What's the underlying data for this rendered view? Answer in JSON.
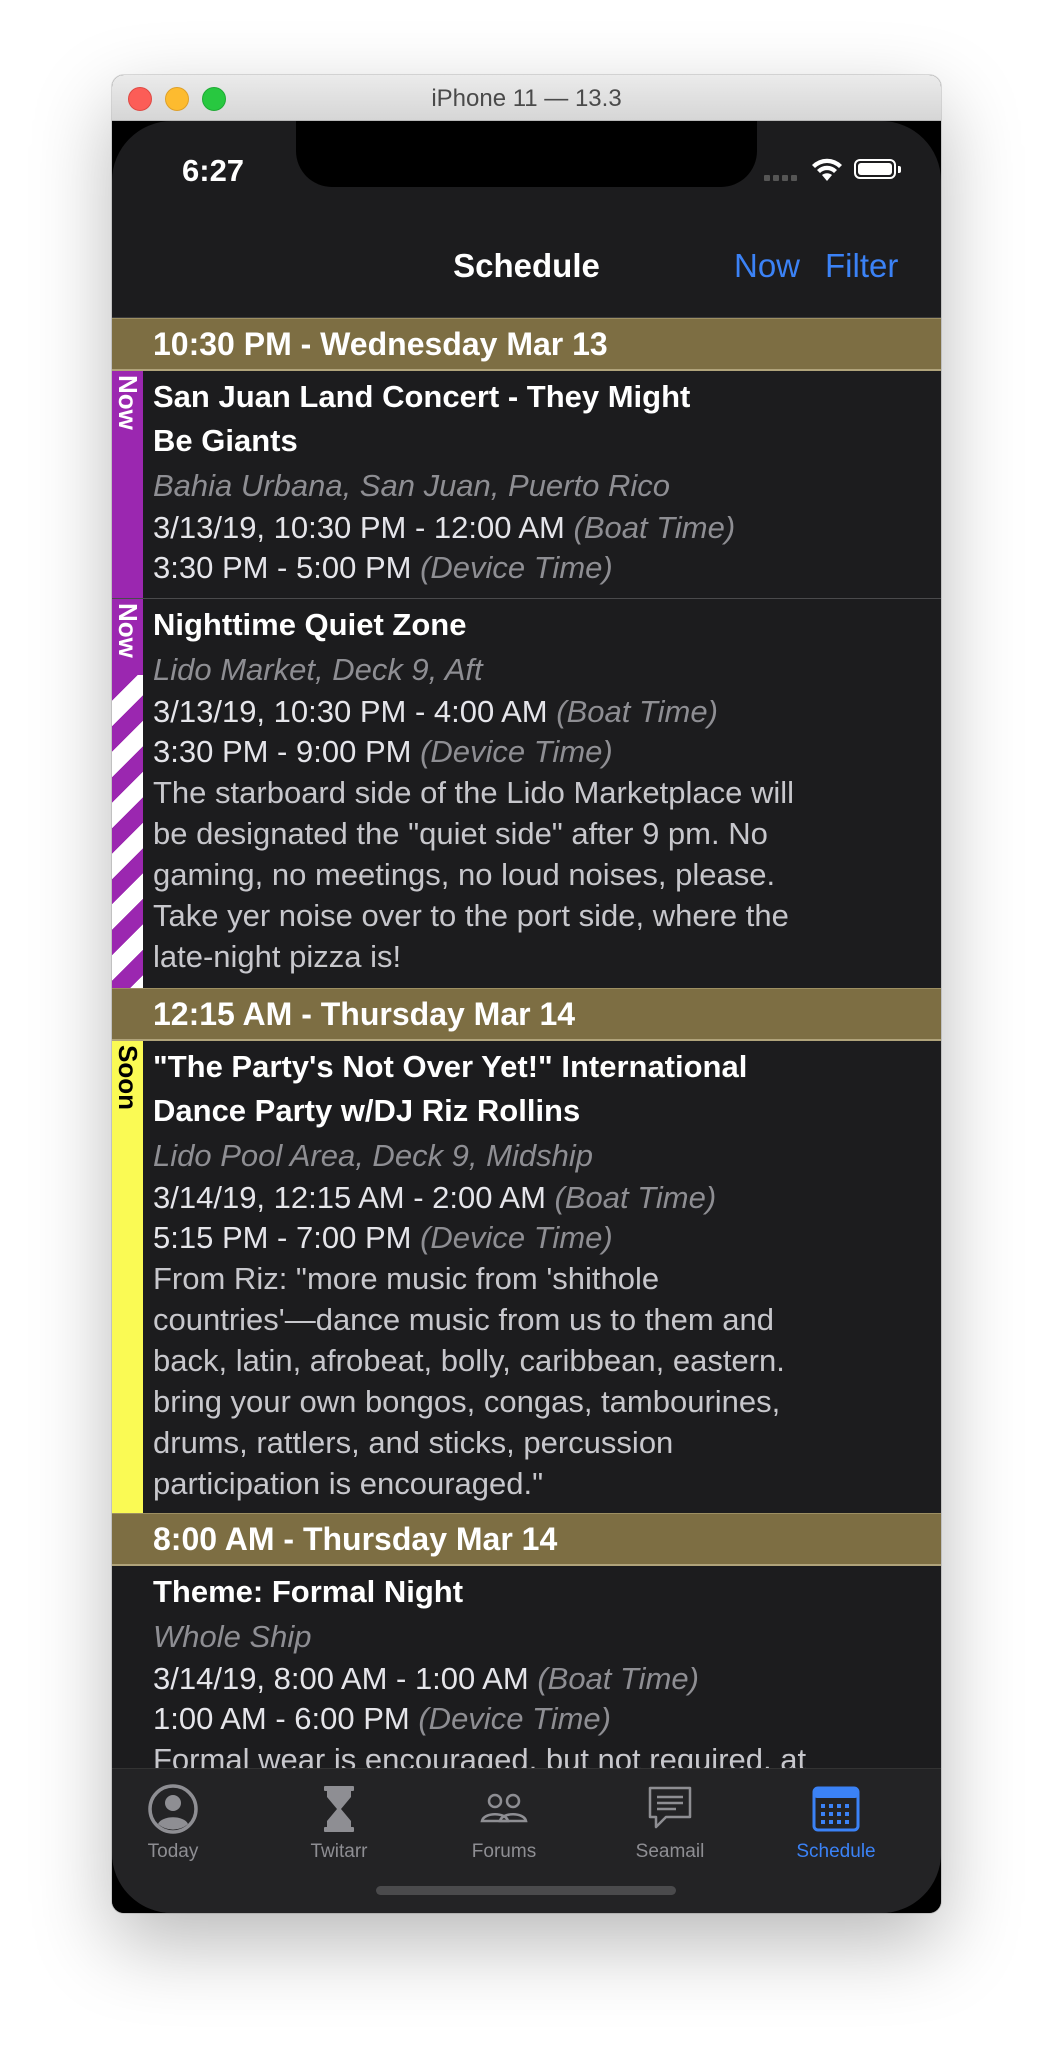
{
  "window": {
    "title": "iPhone 11 — 13.3"
  },
  "status_bar": {
    "time": "6:27"
  },
  "nav": {
    "title": "Schedule",
    "now_label": "Now",
    "filter_label": "Filter"
  },
  "sections": [
    {
      "header": "10:30 PM - Wednesday Mar 13",
      "events": [
        {
          "badge": "Now",
          "title_lines": [
            "San Juan Land Concert - They Might",
            "Be Giants"
          ],
          "location": "Bahia Urbana, San Juan, Puerto Rico",
          "boat_time": "3/13/19, 10:30 PM - 12:00 AM",
          "boat_label": "(Boat Time)",
          "device_time": "3:30 PM - 5:00 PM",
          "device_label": "(Device Time)"
        },
        {
          "badge": "Now",
          "title_lines": [
            "Nighttime Quiet Zone"
          ],
          "location": "Lido Market, Deck 9, Aft",
          "boat_time": "3/13/19, 10:30 PM - 4:00 AM",
          "boat_label": "(Boat Time)",
          "device_time": "3:30 PM - 9:00 PM",
          "device_label": "(Device Time)",
          "desc_lines": [
            "The starboard side of the Lido Marketplace will",
            "be designated the \"quiet side\" after 9 pm. No",
            "gaming, no meetings, no loud noises, please.",
            "Take yer noise over to the port side, where the",
            "late-night pizza is!"
          ]
        }
      ]
    },
    {
      "header": "12:15 AM - Thursday Mar 14",
      "events": [
        {
          "badge": "Soon",
          "title_lines": [
            "\"The Party's Not Over Yet!\" International",
            "Dance Party w/DJ Riz Rollins"
          ],
          "location": "Lido Pool Area, Deck 9, Midship",
          "boat_time": "3/14/19, 12:15 AM - 2:00 AM",
          "boat_label": "(Boat Time)",
          "device_time": "5:15 PM - 7:00 PM",
          "device_label": "(Device Time)",
          "desc_lines": [
            "From Riz: \"more music from 'shithole",
            "countries'—dance music from us to them and",
            "back, latin, afrobeat, bolly, caribbean, eastern.",
            "bring your own bongos, congas, tambourines,",
            "drums, rattlers, and sticks, percussion",
            "participation is encouraged.\""
          ]
        }
      ]
    },
    {
      "header": "8:00 AM - Thursday Mar 14",
      "events": [
        {
          "title_lines": [
            "Theme: Formal Night"
          ],
          "location": "Whole Ship",
          "boat_time": "3/14/19, 8:00 AM - 1:00 AM",
          "boat_label": "(Boat Time)",
          "device_time": "1:00 AM - 6:00 PM",
          "device_label": "(Device Time)",
          "desc_lines": [
            "Formal wear is encouraged, but not required, at"
          ]
        }
      ]
    }
  ],
  "tabs": [
    {
      "label": "Today",
      "icon": "person-circle-icon"
    },
    {
      "label": "Twitarr",
      "icon": "hourglass-icon"
    },
    {
      "label": "Forums",
      "icon": "people-icon"
    },
    {
      "label": "Seamail",
      "icon": "chat-bubble-icon"
    },
    {
      "label": "Schedule",
      "icon": "calendar-icon",
      "active": true
    }
  ],
  "colors": {
    "accent": "#3b82f6",
    "section_header": "#7d6e43",
    "now_badge": "#9b27b0",
    "soon_badge": "#fafa54",
    "background": "#1c1c1e"
  }
}
